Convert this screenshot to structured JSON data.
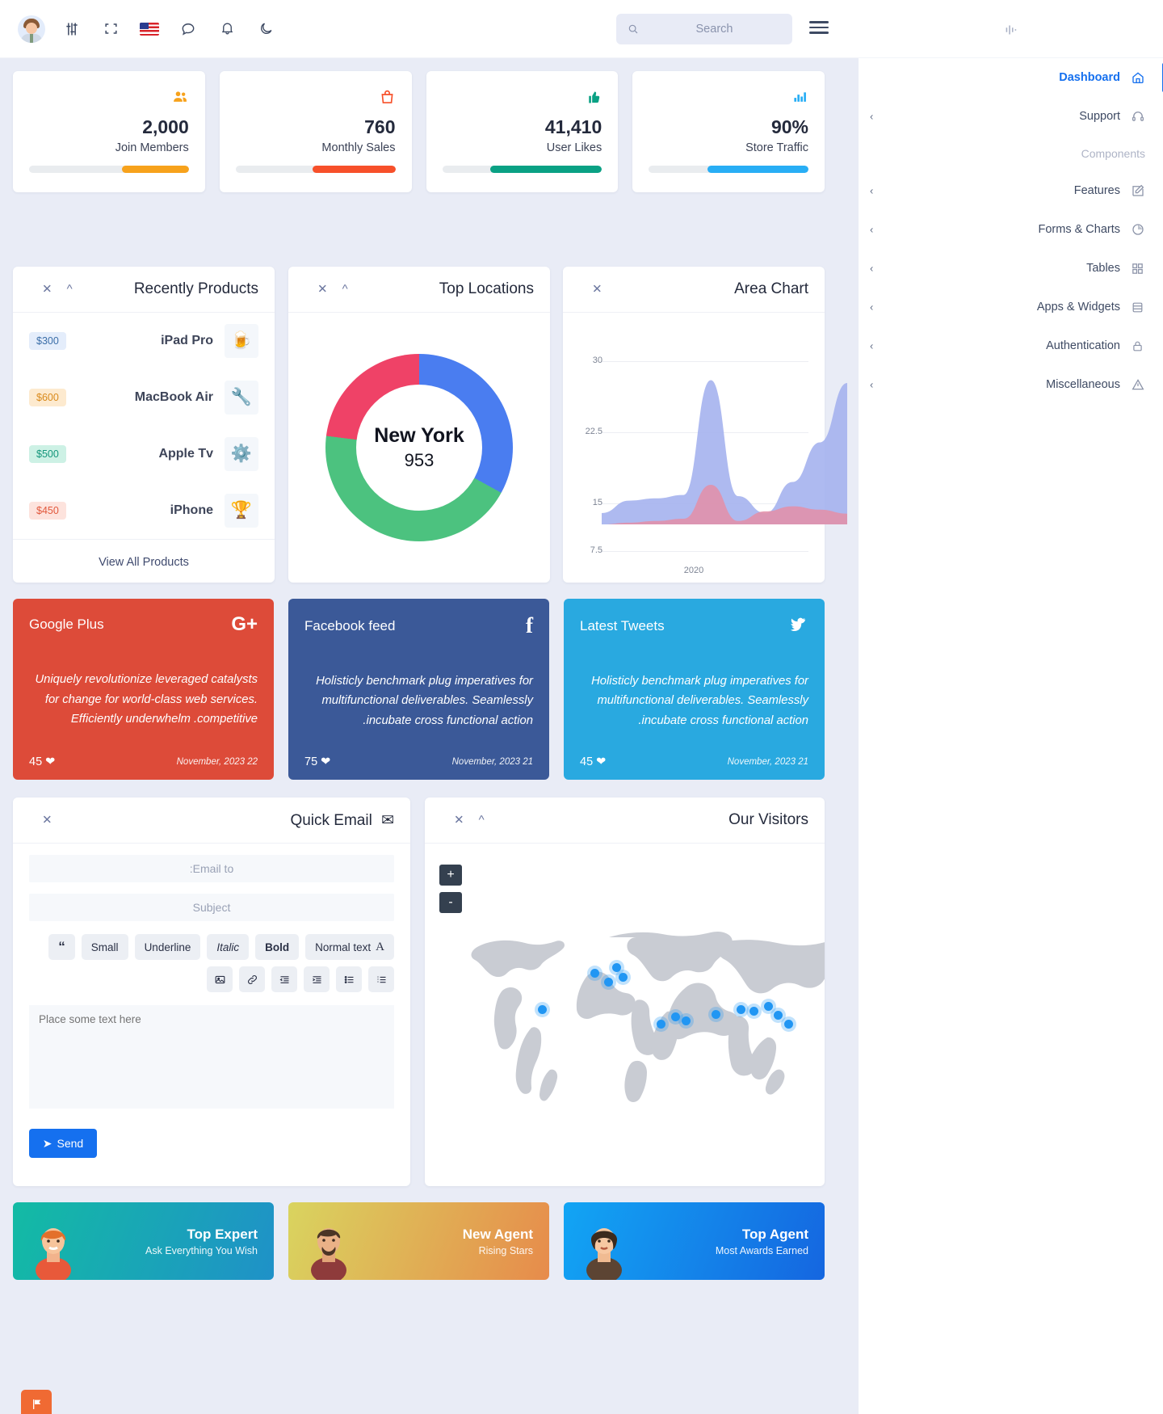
{
  "topbar": {
    "icons": [
      "avatar",
      "sliders-icon",
      "fullscreen-icon",
      "flag-us-icon",
      "chat-icon",
      "bell-icon",
      "moon-icon"
    ],
    "search": {
      "placeholder": "Search",
      "value": ""
    },
    "menu_icon": "hamburger-icon",
    "sound_icon": "sound-wave-icon"
  },
  "sidebar": {
    "items": [
      {
        "label": "Dashboard",
        "icon": "home-icon",
        "active": true,
        "chevron": false
      },
      {
        "label": "Support",
        "icon": "headset-icon",
        "active": false,
        "chevron": true
      },
      {
        "label": "Components",
        "section": true
      },
      {
        "label": "Features",
        "icon": "edit-icon",
        "active": false,
        "chevron": true
      },
      {
        "label": "Forms & Charts",
        "icon": "pie-chart-icon",
        "active": false,
        "chevron": true
      },
      {
        "label": "Tables",
        "icon": "grid-icon",
        "active": false,
        "chevron": true
      },
      {
        "label": "Apps & Widgets",
        "icon": "database-icon",
        "active": false,
        "chevron": true
      },
      {
        "label": "Authentication",
        "icon": "lock-icon",
        "active": false,
        "chevron": true
      },
      {
        "label": "Miscellaneous",
        "icon": "warning-icon",
        "active": false,
        "chevron": true
      }
    ]
  },
  "stats": [
    {
      "value": "2,000",
      "label": "Join Members",
      "icon": "users-icon",
      "color": "#f7a21c",
      "progress": 42
    },
    {
      "value": "760",
      "label": "Monthly Sales",
      "icon": "shopping-bag-icon",
      "color": "#f7502a",
      "progress": 52
    },
    {
      "value": "41,410",
      "label": "User Likes",
      "icon": "thumbs-up-icon",
      "color": "#0aa184",
      "progress": 70
    },
    {
      "value": "90%",
      "label": "Store Traffic",
      "icon": "bar-chart-icon",
      "color": "#28aef5",
      "progress": 63
    }
  ],
  "products": {
    "title": "Recently Products",
    "footer_link": "View All Products",
    "items": [
      {
        "price": "$300",
        "name": "iPad Pro",
        "icon": "beer-glass-icon",
        "badge_bg": "#e4edfb",
        "badge_fg": "#3b6ea8"
      },
      {
        "price": "$600",
        "name": "MacBook Air",
        "icon": "wrench-gear-icon",
        "badge_bg": "#fdeacf",
        "badge_fg": "#d98a1b"
      },
      {
        "price": "$500",
        "name": "Apple Tv",
        "icon": "gear-check-icon",
        "badge_bg": "#cdf1e5",
        "badge_fg": "#14967b"
      },
      {
        "price": "$450",
        "name": "iPhone",
        "icon": "trophy-icon",
        "badge_bg": "#fde3dd",
        "badge_fg": "#e2583c"
      }
    ]
  },
  "top_locations": {
    "title": "Top Locations",
    "center_city": "New York",
    "center_value": "953"
  },
  "area_chart": {
    "title": "Area Chart"
  },
  "chart_data": [
    {
      "type": "pie",
      "title": "Top Locations",
      "labels": [
        "Blue segment",
        "Green segment",
        "Pink segment"
      ],
      "values": [
        33,
        44,
        23
      ],
      "colors": [
        "#4a7df0",
        "#4cc27f",
        "#ef4267"
      ],
      "center_label": "New York",
      "center_value": 953,
      "legend": "none"
    },
    {
      "type": "area",
      "title": "Area Chart",
      "xlabel": "2020",
      "ylabel": "",
      "ylim": [
        0,
        30
      ],
      "yticks": [
        0,
        7.5,
        15,
        22.5,
        30
      ],
      "xtick_labels": [
        "2020"
      ],
      "grid": true,
      "legend": "none",
      "x": [
        0,
        1,
        2,
        3,
        4,
        5,
        6,
        7,
        8,
        9
      ],
      "series": [
        {
          "name": "Series 1",
          "color": "#a3b1ee",
          "values": [
            2.0,
            4.2,
            4.6,
            5.2,
            25.5,
            5.0,
            2.0,
            7.5,
            14.5,
            25.0
          ]
        },
        {
          "name": "Series 2",
          "color": "#e290a8",
          "values": [
            0.0,
            0.3,
            0.6,
            1.0,
            7.0,
            0.6,
            2.3,
            3.2,
            2.6,
            1.9
          ]
        }
      ]
    }
  ],
  "social_cards": [
    {
      "title": "Google Plus",
      "logo": "google-plus-icon",
      "text": "Uniquely revolutionize leveraged catalysts for change for world-class web services. Efficiently underwhelm .competitive",
      "likes": "45",
      "date": "November, 2023 22",
      "color": "#dd4b39"
    },
    {
      "title": "Facebook feed",
      "logo": "facebook-icon",
      "text": "Holisticly benchmark plug imperatives for multifunctional deliverables. Seamlessly .incubate cross functional action",
      "likes": "75",
      "date": "November, 2023 21",
      "color": "#3b5998"
    },
    {
      "title": "Latest Tweets",
      "logo": "twitter-icon",
      "text": "Holisticly benchmark plug imperatives for multifunctional deliverables. Seamlessly .incubate cross functional action",
      "likes": "45",
      "date": "November, 2023 21",
      "color": "#29a9e0"
    }
  ],
  "quick_email": {
    "title": "Quick Email",
    "title_icon": "envelope-icon",
    "email_placeholder": ":Email to",
    "subject_placeholder": "Subject",
    "body_placeholder": "Place some text here",
    "send_label": "Send",
    "send_icon": "paper-plane-icon",
    "toolbar_row1": [
      {
        "label": "Normal text",
        "icon": "font-size-icon"
      },
      {
        "label": "Bold",
        "style": "bold"
      },
      {
        "label": "Italic",
        "style": "italic"
      },
      {
        "label": "Underline"
      },
      {
        "label": "Small"
      },
      {
        "label": "",
        "icon": "quote-icon"
      }
    ],
    "toolbar_row2": [
      "list-ol-icon",
      "list-ul-icon",
      "outdent-icon",
      "indent-icon",
      "link-icon",
      "image-icon"
    ]
  },
  "visitors": {
    "title": "Our Visitors",
    "zoom_in": "+",
    "zoom_out": "-"
  },
  "agents": [
    {
      "title": "Top Expert",
      "subtitle": "Ask Everything You Wish",
      "from": "#13bba4",
      "to": "#1f91c8"
    },
    {
      "title": "New Agent",
      "subtitle": "Rising Stars",
      "from": "#d9d45f",
      "to": "#e78b4b"
    },
    {
      "title": "Top Agent",
      "subtitle": "Most Awards Earned",
      "from": "#12a5f4",
      "to": "#1566e0"
    }
  ],
  "fab_icon": "flag-icon"
}
